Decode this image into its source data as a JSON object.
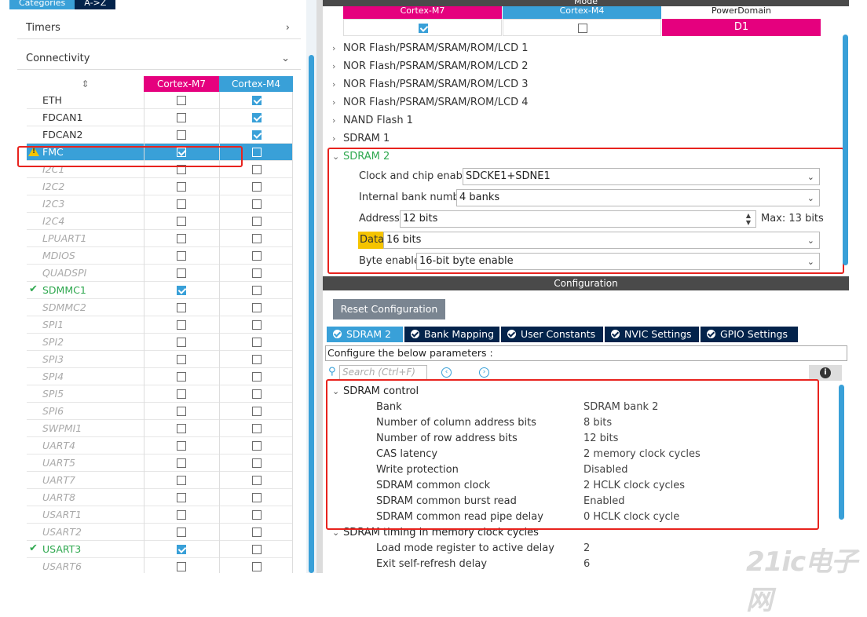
{
  "left": {
    "tabs": [
      "Categories",
      "A->Z"
    ],
    "timers_label": "Timers",
    "connectivity_label": "Connectivity",
    "col_m7": "Cortex-M7",
    "col_m4": "Cortex-M4",
    "rows": [
      {
        "name": "ETH",
        "m7": false,
        "m4": true,
        "state": "normal"
      },
      {
        "name": "FDCAN1",
        "m7": false,
        "m4": true,
        "state": "normal"
      },
      {
        "name": "FDCAN2",
        "m7": false,
        "m4": true,
        "state": "normal"
      },
      {
        "name": "FMC",
        "m7": true,
        "m4": false,
        "state": "selected"
      },
      {
        "name": "I2C1",
        "m7": false,
        "m4": false,
        "state": "disabled"
      },
      {
        "name": "I2C2",
        "m7": false,
        "m4": false,
        "state": "disabled"
      },
      {
        "name": "I2C3",
        "m7": false,
        "m4": false,
        "state": "disabled"
      },
      {
        "name": "I2C4",
        "m7": false,
        "m4": false,
        "state": "disabled"
      },
      {
        "name": "LPUART1",
        "m7": false,
        "m4": false,
        "state": "disabled"
      },
      {
        "name": "MDIOS",
        "m7": false,
        "m4": false,
        "state": "disabled"
      },
      {
        "name": "QUADSPI",
        "m7": false,
        "m4": false,
        "state": "disabled"
      },
      {
        "name": "SDMMC1",
        "m7": true,
        "m4": false,
        "state": "enabled"
      },
      {
        "name": "SDMMC2",
        "m7": false,
        "m4": false,
        "state": "disabled"
      },
      {
        "name": "SPI1",
        "m7": false,
        "m4": false,
        "state": "disabled"
      },
      {
        "name": "SPI2",
        "m7": false,
        "m4": false,
        "state": "disabled"
      },
      {
        "name": "SPI3",
        "m7": false,
        "m4": false,
        "state": "disabled"
      },
      {
        "name": "SPI4",
        "m7": false,
        "m4": false,
        "state": "disabled"
      },
      {
        "name": "SPI5",
        "m7": false,
        "m4": false,
        "state": "disabled"
      },
      {
        "name": "SPI6",
        "m7": false,
        "m4": false,
        "state": "disabled"
      },
      {
        "name": "SWPMI1",
        "m7": false,
        "m4": false,
        "state": "disabled"
      },
      {
        "name": "UART4",
        "m7": false,
        "m4": false,
        "state": "disabled"
      },
      {
        "name": "UART5",
        "m7": false,
        "m4": false,
        "state": "disabled"
      },
      {
        "name": "UART7",
        "m7": false,
        "m4": false,
        "state": "disabled"
      },
      {
        "name": "UART8",
        "m7": false,
        "m4": false,
        "state": "disabled"
      },
      {
        "name": "USART1",
        "m7": false,
        "m4": false,
        "state": "disabled"
      },
      {
        "name": "USART2",
        "m7": false,
        "m4": false,
        "state": "disabled"
      },
      {
        "name": "USART3",
        "m7": true,
        "m4": false,
        "state": "enabled"
      },
      {
        "name": "USART6",
        "m7": false,
        "m4": false,
        "state": "disabled"
      }
    ]
  },
  "mode": {
    "title": "Mode",
    "col_m7": "Cortex-M7",
    "col_m4": "Cortex-M4",
    "col_pd": "PowerDomain",
    "m7_checked": true,
    "m4_checked": false,
    "pd_value": "D1",
    "tree": [
      "NOR Flash/PSRAM/SRAM/ROM/LCD 1",
      "NOR Flash/PSRAM/SRAM/ROM/LCD 2",
      "NOR Flash/PSRAM/SRAM/ROM/LCD 3",
      "NOR Flash/PSRAM/SRAM/ROM/LCD 4",
      "NAND Flash 1",
      "SDRAM 1"
    ],
    "sdram2_label": "SDRAM 2",
    "clock_label": "Clock and chip enable",
    "clock_value": "SDCKE1+SDNE1",
    "bank_label": "Internal bank number",
    "bank_value": "4 banks",
    "address_label": "Address",
    "address_value": "12 bits",
    "address_max": "Max: 13 bits",
    "data_label": "Data",
    "data_value": "16 bits",
    "byte_label": "Byte enable",
    "byte_value": "16-bit byte enable"
  },
  "config": {
    "title": "Configuration",
    "reset_label": "Reset Configuration",
    "tabs": [
      "SDRAM 2",
      "Bank Mapping",
      "User Constants",
      "NVIC Settings",
      "GPIO Settings"
    ],
    "desc": "Configure the below parameters :",
    "search_placeholder": "Search (Ctrl+F)",
    "group1": "SDRAM control",
    "group1_items": [
      {
        "label": "Bank",
        "value": "SDRAM bank 2"
      },
      {
        "label": "Number of column address bits",
        "value": "8 bits"
      },
      {
        "label": "Number of row address bits",
        "value": "12 bits"
      },
      {
        "label": "CAS latency",
        "value": "2 memory clock cycles"
      },
      {
        "label": "Write protection",
        "value": "Disabled"
      },
      {
        "label": "SDRAM common clock",
        "value": "2 HCLK clock cycles"
      },
      {
        "label": "SDRAM common burst read",
        "value": "Enabled"
      },
      {
        "label": "SDRAM common read pipe delay",
        "value": "0 HCLK clock cycle"
      }
    ],
    "group2": "SDRAM timing in memory clock cycles",
    "group2_items": [
      {
        "label": "Load mode register to active delay",
        "value": "2"
      },
      {
        "label": "Exit self-refresh delay",
        "value": "6"
      }
    ]
  },
  "watermark": "21ic电子网",
  "colors": {
    "m7": "#e5007e",
    "m4": "#39a0d8",
    "highlight": "#e8231e",
    "data_hl": "#f5c400"
  }
}
